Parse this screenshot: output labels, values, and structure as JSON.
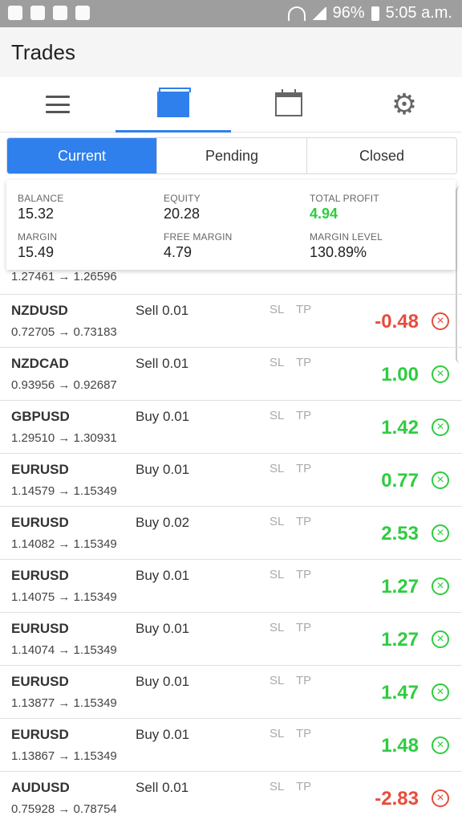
{
  "status": {
    "battery": "96%",
    "time": "5:05 a.m."
  },
  "app": {
    "title": "Trades"
  },
  "segments": [
    "Current",
    "Pending",
    "Closed"
  ],
  "summary": {
    "balance": {
      "label": "BALANCE",
      "value": "15.32"
    },
    "equity": {
      "label": "EQUITY",
      "value": "20.28"
    },
    "total_profit": {
      "label": "TOTAL PROFIT",
      "value": "4.94"
    },
    "margin": {
      "label": "MARGIN",
      "value": "15.49"
    },
    "free_margin": {
      "label": "FREE MARGIN",
      "value": "4.79"
    },
    "margin_level": {
      "label": "MARGIN LEVEL",
      "value": "130.89%"
    }
  },
  "peek_row": {
    "prices": "1.27461 → 1.26596"
  },
  "trades": [
    {
      "symbol": "NZDUSD",
      "side": "Sell 0.01",
      "sl": "SL",
      "tp": "TP",
      "prices": "0.72705 → 0.73183",
      "profit": "-0.48",
      "positive": false
    },
    {
      "symbol": "NZDCAD",
      "side": "Sell 0.01",
      "sl": "SL",
      "tp": "TP",
      "prices": "0.93956 → 0.92687",
      "profit": "1.00",
      "positive": true
    },
    {
      "symbol": "GBPUSD",
      "side": "Buy 0.01",
      "sl": "SL",
      "tp": "TP",
      "prices": "1.29510 → 1.30931",
      "profit": "1.42",
      "positive": true
    },
    {
      "symbol": "EURUSD",
      "side": "Buy 0.01",
      "sl": "SL",
      "tp": "TP",
      "prices": "1.14579 → 1.15349",
      "profit": "0.77",
      "positive": true
    },
    {
      "symbol": "EURUSD",
      "side": "Buy 0.02",
      "sl": "SL",
      "tp": "TP",
      "prices": "1.14082 → 1.15349",
      "profit": "2.53",
      "positive": true
    },
    {
      "symbol": "EURUSD",
      "side": "Buy 0.01",
      "sl": "SL",
      "tp": "TP",
      "prices": "1.14075 → 1.15349",
      "profit": "1.27",
      "positive": true
    },
    {
      "symbol": "EURUSD",
      "side": "Buy 0.01",
      "sl": "SL",
      "tp": "TP",
      "prices": "1.14074 → 1.15349",
      "profit": "1.27",
      "positive": true
    },
    {
      "symbol": "EURUSD",
      "side": "Buy 0.01",
      "sl": "SL",
      "tp": "TP",
      "prices": "1.13877 → 1.15349",
      "profit": "1.47",
      "positive": true
    },
    {
      "symbol": "EURUSD",
      "side": "Buy 0.01",
      "sl": "SL",
      "tp": "TP",
      "prices": "1.13867 → 1.15349",
      "profit": "1.48",
      "positive": true
    },
    {
      "symbol": "AUDUSD",
      "side": "Sell 0.01",
      "sl": "SL",
      "tp": "TP",
      "prices": "0.75928 → 0.78754",
      "profit": "-2.83",
      "positive": false
    }
  ],
  "icons": {
    "close": "close-circle-icon",
    "menu": "menu-icon",
    "trades": "folder-icon",
    "calendar": "calendar-icon",
    "settings": "gear-icon"
  }
}
